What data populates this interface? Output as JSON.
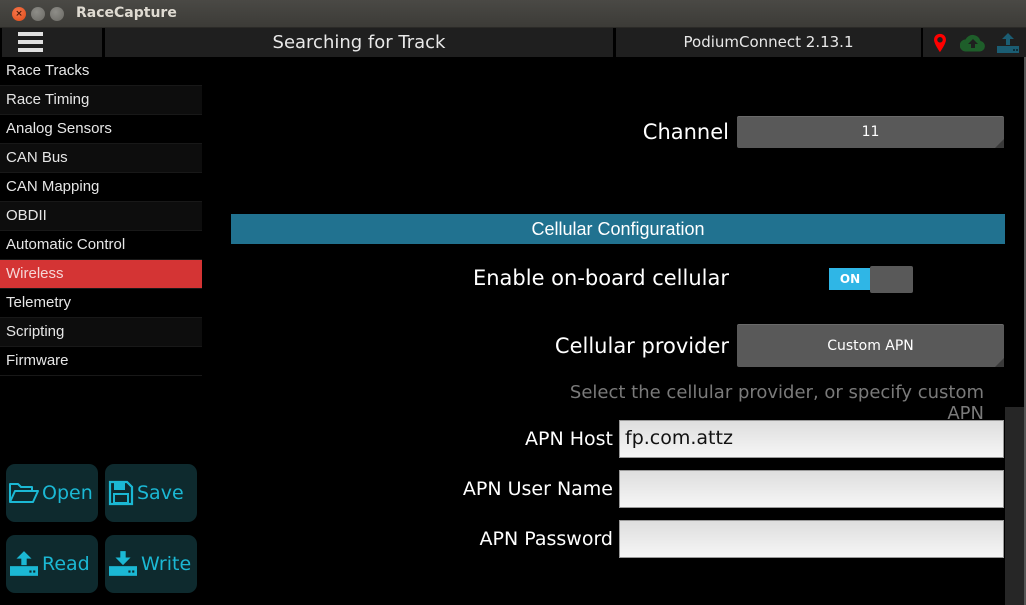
{
  "window": {
    "title": "RaceCapture"
  },
  "header": {
    "status": "Searching for Track",
    "podium": "PodiumConnect 2.13.1",
    "icons": [
      "map-marker-icon",
      "cloud-upload-icon",
      "upload-icon"
    ],
    "colors": {
      "marker": "#ff0000",
      "cloud": "#1e5e2a",
      "upload": "#1b5d73"
    }
  },
  "sidebar": {
    "items": [
      {
        "label": "Race Tracks"
      },
      {
        "label": "Race Timing"
      },
      {
        "label": "Analog Sensors"
      },
      {
        "label": "CAN Bus"
      },
      {
        "label": "CAN Mapping"
      },
      {
        "label": "OBDII"
      },
      {
        "label": "Automatic Control"
      },
      {
        "label": "Wireless",
        "active": true
      },
      {
        "label": "Telemetry"
      },
      {
        "label": "Scripting"
      },
      {
        "label": "Firmware"
      }
    ],
    "active_color": "#d43434"
  },
  "actions": {
    "open": "Open",
    "save": "Save",
    "read": "Read",
    "write": "Write",
    "accent": "#1bb8d4"
  },
  "main": {
    "channel_label": "Channel",
    "channel_value": "11",
    "section_title": "Cellular Configuration",
    "enable_label": "Enable on-board cellular",
    "enable_state": "ON",
    "provider_label": "Cellular provider",
    "provider_value": "Custom APN",
    "provider_hint": "Select the cellular provider, or specify custom APN",
    "apn_host_label": "APN Host",
    "apn_host_value": "fp.com.attz",
    "apn_user_label": "APN User Name",
    "apn_user_value": "",
    "apn_pass_label": "APN Password",
    "apn_pass_value": "",
    "section_color": "#217290"
  }
}
